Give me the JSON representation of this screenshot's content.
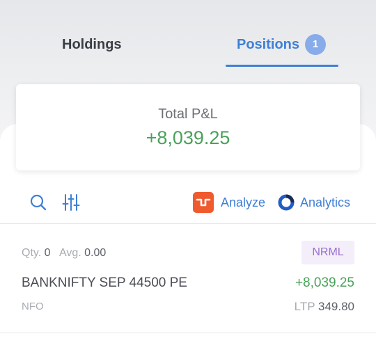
{
  "tabs": {
    "holdings": "Holdings",
    "positions": "Positions",
    "positions_count": "1"
  },
  "pnl": {
    "label": "Total P&L",
    "value": "+8,039.25"
  },
  "toolbar": {
    "search_icon": "search-icon",
    "filter_icon": "filter-sliders-icon",
    "analyze_label": "Analyze",
    "analytics_label": "Analytics"
  },
  "position": {
    "qty_label": "Qty.",
    "qty": "0",
    "avg_label": "Avg.",
    "avg": "0.00",
    "product": "NRML",
    "instrument": "BANKNIFTY SEP 44500 PE",
    "pnl": "+8,039.25",
    "exchange": "NFO",
    "ltp_label": "LTP",
    "ltp": "349.80"
  },
  "colors": {
    "accent": "#3f7fd6",
    "profit": "#4aa15a",
    "badge": "#88acea",
    "analyze_brand": "#ef5a2f",
    "product_badge_bg": "#f3eefa",
    "product_badge_text": "#9a70cc"
  }
}
